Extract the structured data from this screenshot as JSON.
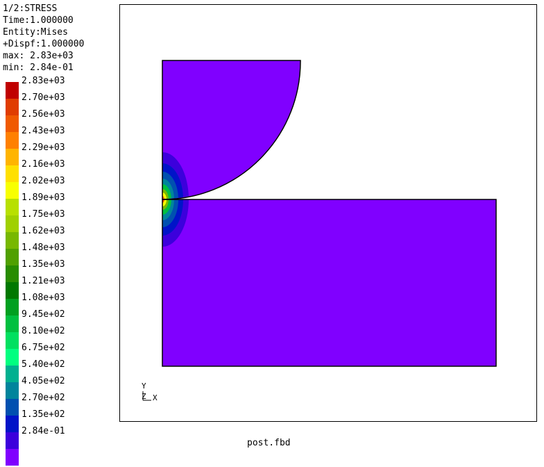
{
  "info": {
    "step": "1/2:STRESS",
    "time": "Time:1.000000",
    "entity": "Entity:Mises",
    "dispf": "+Dispf:1.000000",
    "max": "max: 2.83e+03",
    "min": "min: 2.84e-01"
  },
  "legend": [
    {
      "label": "2.83e+03",
      "color": "#c00000"
    },
    {
      "label": "2.70e+03",
      "color": "#e03c00"
    },
    {
      "label": "2.56e+03",
      "color": "#f05a00"
    },
    {
      "label": "2.43e+03",
      "color": "#ff8000"
    },
    {
      "label": "2.29e+03",
      "color": "#ffb400"
    },
    {
      "label": "2.16e+03",
      "color": "#ffe000"
    },
    {
      "label": "2.02e+03",
      "color": "#f8ff00"
    },
    {
      "label": "1.89e+03",
      "color": "#b8e000"
    },
    {
      "label": "1.75e+03",
      "color": "#a0d000"
    },
    {
      "label": "1.62e+03",
      "color": "#78b800"
    },
    {
      "label": "1.48e+03",
      "color": "#50a000"
    },
    {
      "label": "1.35e+03",
      "color": "#288c00"
    },
    {
      "label": "1.21e+03",
      "color": "#007800"
    },
    {
      "label": "1.08e+03",
      "color": "#00a020"
    },
    {
      "label": "9.45e+02",
      "color": "#00c040"
    },
    {
      "label": "8.10e+02",
      "color": "#00e060"
    },
    {
      "label": "6.75e+02",
      "color": "#00ff80"
    },
    {
      "label": "5.40e+02",
      "color": "#00b090"
    },
    {
      "label": "4.05e+02",
      "color": "#00849c"
    },
    {
      "label": "2.70e+02",
      "color": "#0050b0"
    },
    {
      "label": "1.35e+02",
      "color": "#0014c8"
    },
    {
      "label": "2.84e-01",
      "color": "#3c00dc"
    },
    {
      "label": "",
      "color": "#8000ff"
    }
  ],
  "axes": {
    "y_label": "Y",
    "z_label": "Z",
    "x_label": "X"
  },
  "colors": {
    "base": "#8000ff",
    "outline": "#000000"
  },
  "footer": {
    "filename": "post.fbd"
  }
}
